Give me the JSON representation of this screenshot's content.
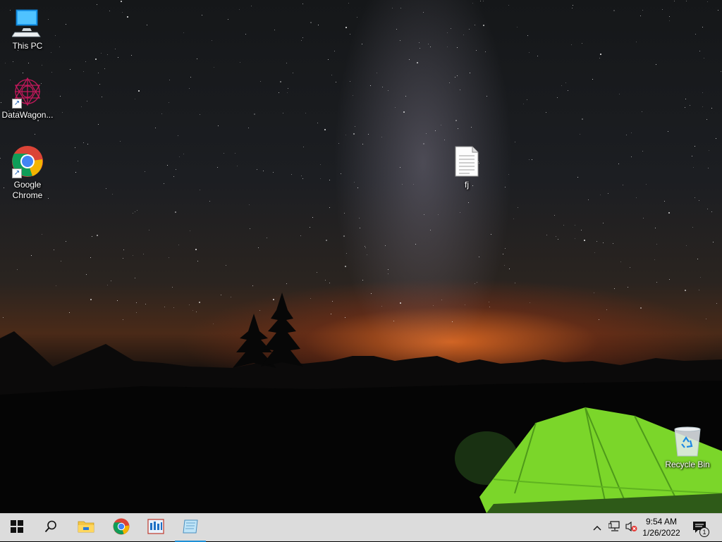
{
  "desktop": {
    "icons": [
      {
        "label": "This PC",
        "icon": "computer-icon"
      },
      {
        "label": "DataWagon...",
        "icon": "datawagon-app-icon"
      },
      {
        "label": "Google Chrome",
        "icon": "chrome-icon"
      },
      {
        "label": "fj",
        "icon": "text-file-icon"
      },
      {
        "label": "Recycle Bin",
        "icon": "recycle-bin-icon"
      }
    ]
  },
  "taskbar": {
    "pinned": [
      {
        "name": "start",
        "icon": "windows-logo-icon"
      },
      {
        "name": "search",
        "icon": "search-icon"
      },
      {
        "name": "file-explorer",
        "icon": "folder-icon"
      },
      {
        "name": "chrome",
        "icon": "chrome-icon"
      },
      {
        "name": "app",
        "icon": "app-window-icon"
      },
      {
        "name": "notepad",
        "icon": "notepad-icon",
        "active": true
      }
    ],
    "tray": {
      "time": "9:54 AM",
      "date": "1/26/2022",
      "notification_count": "1"
    }
  },
  "colors": {
    "taskbar_bg": "#dcdcdc",
    "active_indicator": "#1e90d6",
    "tent": "#7bd62a"
  }
}
